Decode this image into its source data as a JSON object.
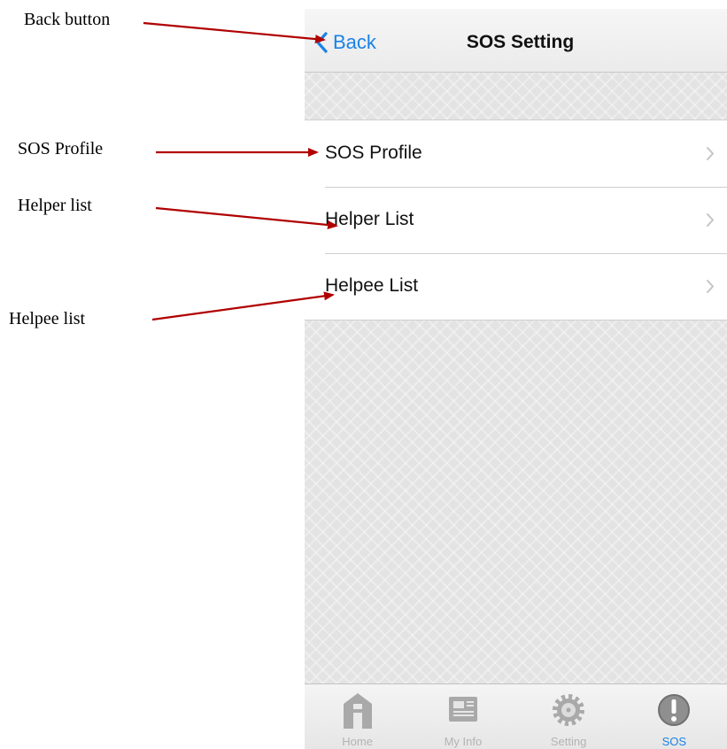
{
  "annotations": {
    "back_button": "Back button",
    "sos_profile": "SOS Profile",
    "helper_list": "Helper list",
    "helpee_list": "Helpee list",
    "arrow_color": "#b00000"
  },
  "navbar": {
    "back_label": "Back",
    "title": "SOS Setting",
    "back_icon": "chevron-left-icon"
  },
  "menu": {
    "items": [
      {
        "label": "SOS Profile",
        "icon": "chevron-right-icon"
      },
      {
        "label": "Helper List",
        "icon": "chevron-right-icon"
      },
      {
        "label": "Helpee List",
        "icon": "chevron-right-icon"
      }
    ]
  },
  "tabbar": {
    "active_index": 3,
    "tabs": [
      {
        "label": "Home",
        "icon": "home-icon"
      },
      {
        "label": "My Info",
        "icon": "news-icon"
      },
      {
        "label": "Setting",
        "icon": "gear-icon"
      },
      {
        "label": "SOS",
        "icon": "alert-icon"
      }
    ]
  },
  "colors": {
    "accent": "#1a82e8",
    "inactive": "#b3b3b3",
    "background": "#e3e3e3"
  }
}
